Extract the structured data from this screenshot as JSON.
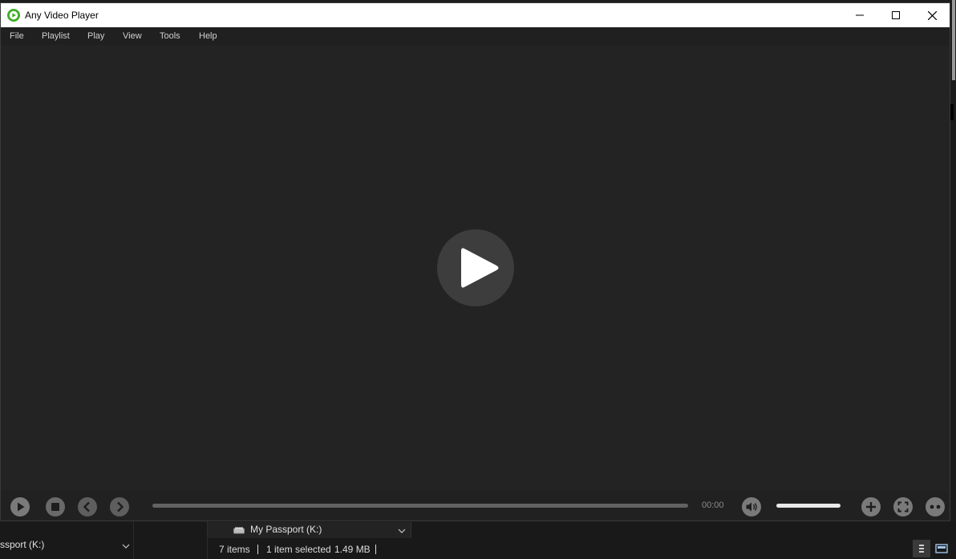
{
  "window": {
    "title": "Any Video Player",
    "accent_color": "#3fae29"
  },
  "menu": [
    "File",
    "Playlist",
    "Play",
    "View",
    "Tools",
    "Help"
  ],
  "controls": {
    "time": "00:00",
    "progress": 0,
    "volume": 1.0
  },
  "explorer": {
    "left_drive": "ssport (K:)",
    "drive_crumb": "My Passport (K:)",
    "status": {
      "items": "7 items",
      "selected": "1 item selected",
      "size": "1.49 MB"
    }
  }
}
